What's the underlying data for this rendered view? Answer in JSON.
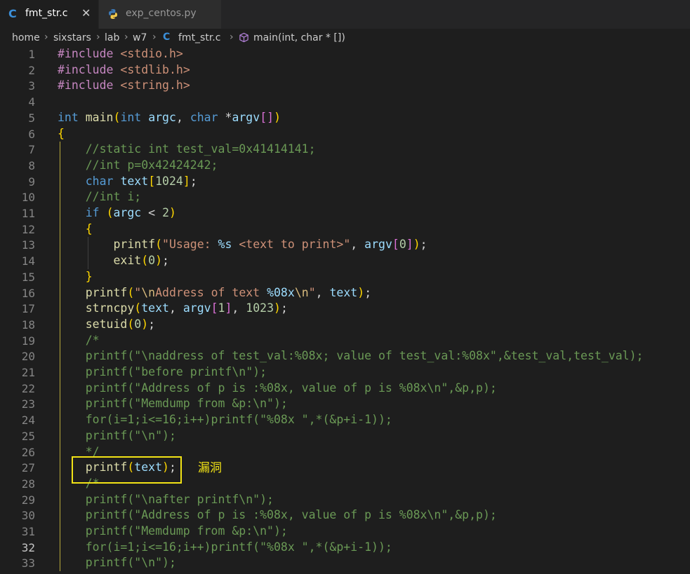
{
  "tabs": [
    {
      "label": "fmt_str.c",
      "icon": "c-language-icon",
      "close": "✕",
      "active": true
    },
    {
      "label": "exp_centos.py",
      "icon": "python-icon",
      "active": false
    }
  ],
  "breadcrumb": {
    "items": [
      "home",
      "sixstars",
      "lab",
      "w7",
      "fmt_str.c",
      "main(int, char * [])"
    ],
    "separator": "›"
  },
  "editor": {
    "current_line": 32,
    "highlight_label": "漏洞",
    "lines": [
      {
        "n": "1",
        "text": "#include <stdio.h>"
      },
      {
        "n": "2",
        "text": "#include <stdlib.h>"
      },
      {
        "n": "3",
        "text": "#include <string.h>"
      },
      {
        "n": "4",
        "text": ""
      },
      {
        "n": "5",
        "text": "int main(int argc, char *argv[])"
      },
      {
        "n": "6",
        "text": "{"
      },
      {
        "n": "7",
        "text": "    //static int test_val=0x41414141;"
      },
      {
        "n": "8",
        "text": "    //int p=0x42424242;"
      },
      {
        "n": "9",
        "text": "    char text[1024];"
      },
      {
        "n": "10",
        "text": "    //int i;"
      },
      {
        "n": "11",
        "text": "    if (argc < 2)"
      },
      {
        "n": "12",
        "text": "    {"
      },
      {
        "n": "13",
        "text": "        printf(\"Usage: %s <text to print>\", argv[0]);"
      },
      {
        "n": "14",
        "text": "        exit(0);"
      },
      {
        "n": "15",
        "text": "    }"
      },
      {
        "n": "16",
        "text": "    printf(\"\\nAddress of text %08x\\n\", text);"
      },
      {
        "n": "17",
        "text": "    strncpy(text, argv[1], 1023);"
      },
      {
        "n": "18",
        "text": "    setuid(0);"
      },
      {
        "n": "19",
        "text": "    /*"
      },
      {
        "n": "20",
        "text": "    printf(\"\\naddress of test_val:%08x; value of test_val:%08x\",&test_val,test_val);"
      },
      {
        "n": "21",
        "text": "    printf(\"before printf\\n\");"
      },
      {
        "n": "22",
        "text": "    printf(\"Address of p is :%08x, value of p is %08x\\n\",&p,p);"
      },
      {
        "n": "23",
        "text": "    printf(\"Memdump from &p:\\n\");"
      },
      {
        "n": "24",
        "text": "    for(i=1;i<=16;i++)printf(\"%08x \",*(&p+i-1));"
      },
      {
        "n": "25",
        "text": "    printf(\"\\n\");"
      },
      {
        "n": "26",
        "text": "    */"
      },
      {
        "n": "27",
        "text": "    printf(text);"
      },
      {
        "n": "28",
        "text": "    /*"
      },
      {
        "n": "29",
        "text": "    printf(\"\\nafter printf\\n\");"
      },
      {
        "n": "30",
        "text": "    printf(\"Address of p is :%08x, value of p is %08x\\n\",&p,p);"
      },
      {
        "n": "31",
        "text": "    printf(\"Memdump from &p:\\n\");"
      },
      {
        "n": "32",
        "text": "    for(i=1;i<=16;i++)printf(\"%08x \",*(&p+i-1));"
      },
      {
        "n": "33",
        "text": "    printf(\"\\n\");"
      }
    ]
  },
  "colors": {
    "background": "#1e1e1e",
    "keyword": "#569cd6",
    "function": "#dcdcaa",
    "string": "#ce9178",
    "comment": "#6a9955",
    "preprocessor": "#c586c0",
    "variable": "#9cdcfe",
    "number": "#b5cea8",
    "annotation": "#f2e316"
  }
}
